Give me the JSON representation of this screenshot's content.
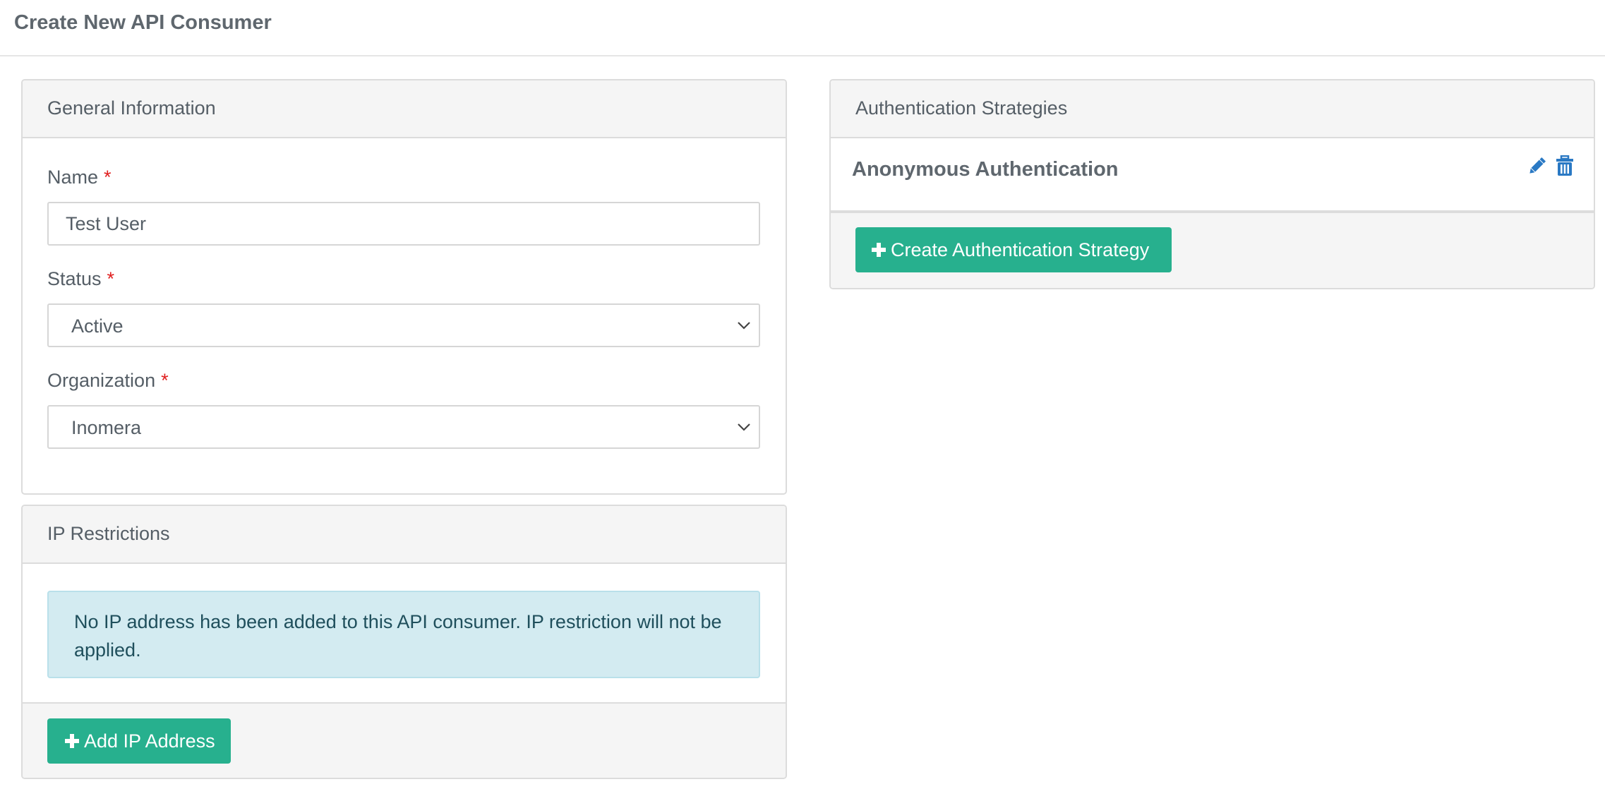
{
  "header": {
    "title": "Create New API Consumer"
  },
  "general": {
    "title": "General Information",
    "name_label": "Name",
    "name_value": "Test User",
    "status_label": "Status",
    "status_value": "Active",
    "organization_label": "Organization",
    "organization_value": "Inomera",
    "required_marker": "*"
  },
  "ip_restrictions": {
    "title": "IP Restrictions",
    "info_message": "No IP address has been added to this API consumer. IP restriction will not be applied.",
    "add_button_label": "Add IP Address"
  },
  "auth": {
    "title": "Authentication Strategies",
    "strategies": [
      {
        "name": "Anonymous Authentication"
      }
    ],
    "create_button_label": "Create Authentication Strategy"
  },
  "icons": {
    "plus": "plus-icon",
    "edit": "pencil-icon",
    "delete": "trash-icon",
    "select_arrow": "chevron-down-icon"
  },
  "colors": {
    "primary_button": "#27b08e",
    "icon_blue": "#2a79c4",
    "required": "#e02020",
    "info_background": "#d3ebf1"
  }
}
